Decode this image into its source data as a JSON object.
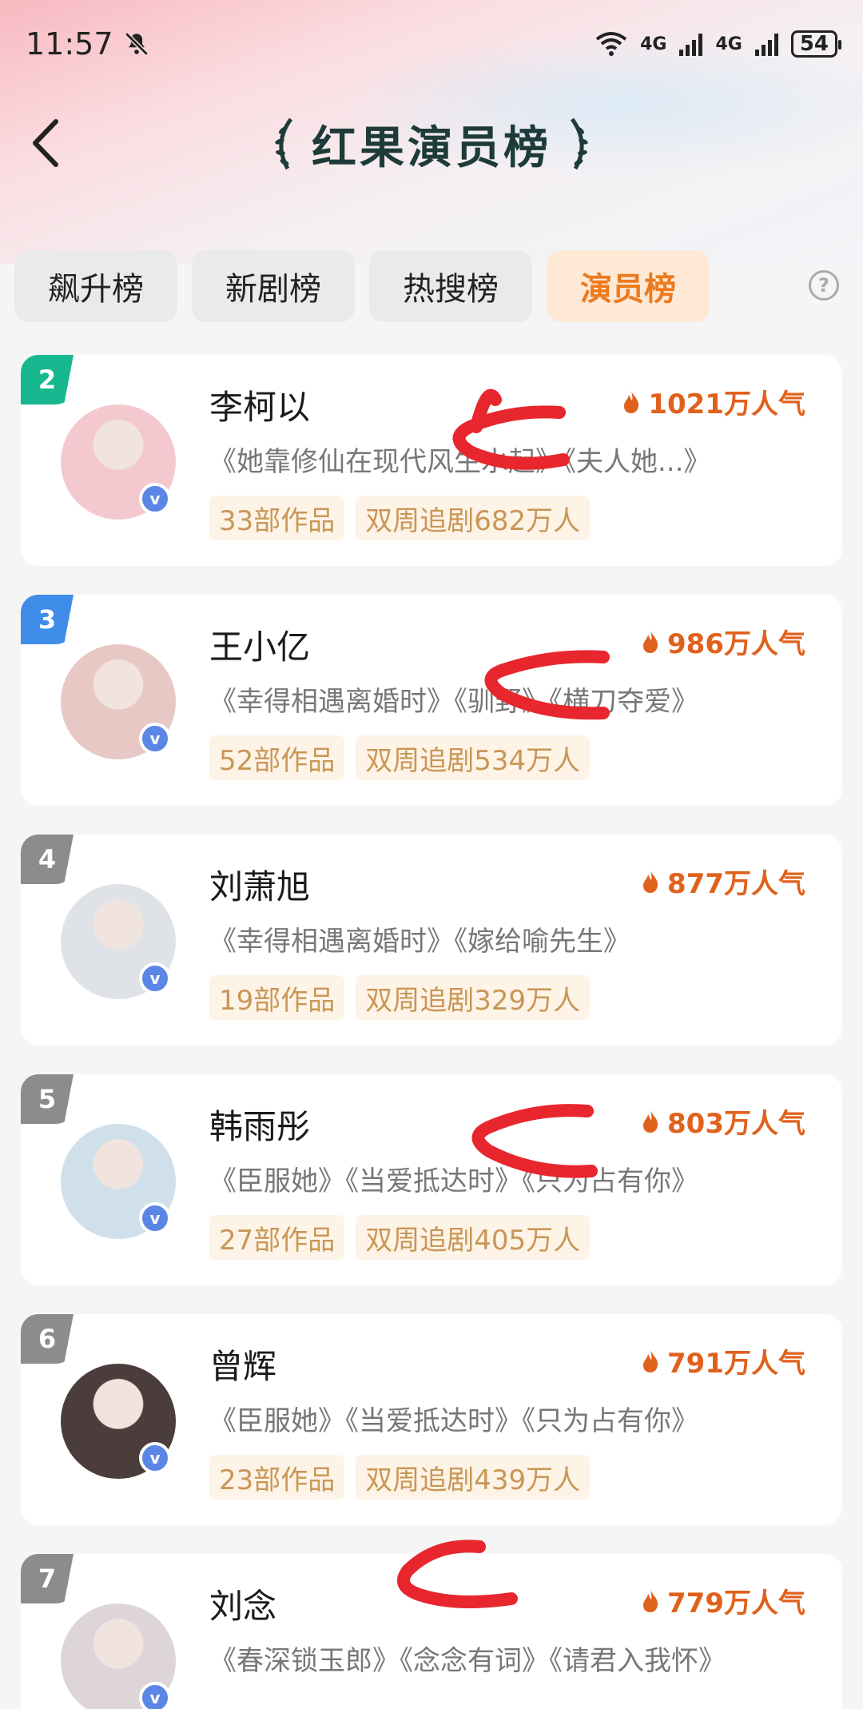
{
  "status": {
    "time": "11:57",
    "net1": "4G",
    "net2": "4G",
    "battery": "54"
  },
  "header": {
    "title": "红果演员榜"
  },
  "tabs": [
    {
      "label": "飙升榜",
      "active": false
    },
    {
      "label": "新剧榜",
      "active": false
    },
    {
      "label": "热搜榜",
      "active": false
    },
    {
      "label": "演员榜",
      "active": true
    }
  ],
  "actors": [
    {
      "rank": "2",
      "rank_color": "#17b890",
      "name": "李柯以",
      "popularity": "1021万人气",
      "works": "《她靠修仙在现代风生水起》《夫人她...》",
      "count": "33部作品",
      "fans": "双周追剧682万人",
      "avatar_color": "#f3c9cf"
    },
    {
      "rank": "3",
      "rank_color": "#3f8de8",
      "name": "王小亿",
      "popularity": "986万人气",
      "works": "《幸得相遇离婚时》《驯野》《横刀夺爱》",
      "count": "52部作品",
      "fans": "双周追剧534万人",
      "avatar_color": "#e7c8c5"
    },
    {
      "rank": "4",
      "rank_color": "#8c8c8c",
      "name": "刘萧旭",
      "popularity": "877万人气",
      "works": "《幸得相遇离婚时》《嫁给喻先生》",
      "count": "19部作品",
      "fans": "双周追剧329万人",
      "avatar_color": "#dfe3e8"
    },
    {
      "rank": "5",
      "rank_color": "#8c8c8c",
      "name": "韩雨彤",
      "popularity": "803万人气",
      "works": "《臣服她》《当爱抵达时》《只为占有你》",
      "count": "27部作品",
      "fans": "双周追剧405万人",
      "avatar_color": "#cfe0ea"
    },
    {
      "rank": "6",
      "rank_color": "#8c8c8c",
      "name": "曾辉",
      "popularity": "791万人气",
      "works": "《臣服她》《当爱抵达时》《只为占有你》",
      "count": "23部作品",
      "fans": "双周追剧439万人",
      "avatar_color": "#4a3d3c"
    },
    {
      "rank": "7",
      "rank_color": "#8c8c8c",
      "name": "刘念",
      "popularity": "779万人气",
      "works": "《春深锁玉郎》《念念有词》《请君入我怀》",
      "count": "",
      "fans": "",
      "avatar_color": "#ddd5d8"
    }
  ],
  "annotations": {
    "arrow_color": "#e8262d"
  }
}
